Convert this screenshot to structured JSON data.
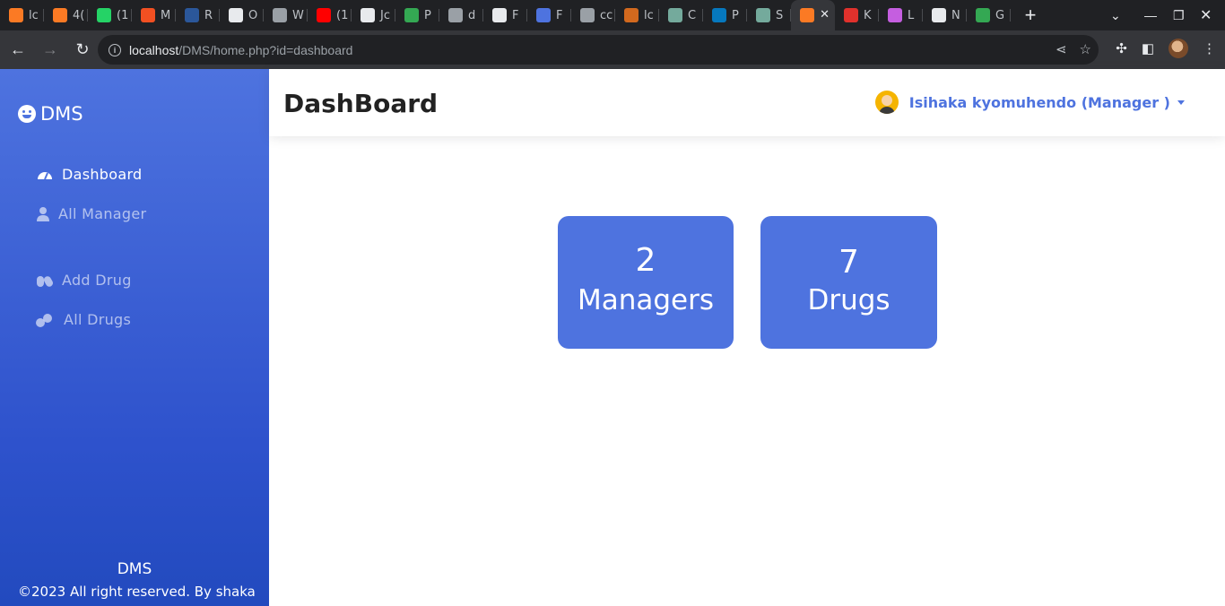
{
  "browser": {
    "tabs": [
      {
        "label": "lc",
        "icon": "xampp-icon",
        "color": "#fb7a24"
      },
      {
        "label": "4(",
        "icon": "xampp-icon",
        "color": "#fb7a24"
      },
      {
        "label": "(1",
        "icon": "whatsapp-icon",
        "color": "#25d366"
      },
      {
        "label": "M",
        "icon": "microsoft-icon",
        "color": "#f25022"
      },
      {
        "label": "R",
        "icon": "word-icon",
        "color": "#2b579a"
      },
      {
        "label": "O",
        "icon": "store-icon",
        "color": "#e8eaed"
      },
      {
        "label": "W",
        "icon": "globe-icon",
        "color": "#9aa0a6"
      },
      {
        "label": "(1",
        "icon": "youtube-icon",
        "color": "#ff0000"
      },
      {
        "label": "Jc",
        "icon": "github-icon",
        "color": "#e8eaed"
      },
      {
        "label": "P",
        "icon": "dot-icon",
        "color": "#34a853"
      },
      {
        "label": "d",
        "icon": "globe-icon",
        "color": "#9aa0a6"
      },
      {
        "label": "F",
        "icon": "flag-icon",
        "color": "#e8eaed"
      },
      {
        "label": "F",
        "icon": "flag-icon",
        "color": "#4e73df"
      },
      {
        "label": "cc",
        "icon": "leaf-icon",
        "color": "#9aa0a6"
      },
      {
        "label": "lc",
        "icon": "tent-icon",
        "color": "#d2691e"
      },
      {
        "label": "C",
        "icon": "openai-icon",
        "color": "#74aa9c"
      },
      {
        "label": "P",
        "icon": "drupal-icon",
        "color": "#0678be"
      },
      {
        "label": "S",
        "icon": "openai-icon",
        "color": "#74aa9c"
      },
      {
        "label": "",
        "icon": "xampp-icon",
        "color": "#fb7a24",
        "active": true
      },
      {
        "label": "K",
        "icon": "laravel-icon",
        "color": "#e0312c"
      },
      {
        "label": "L",
        "icon": "yii-icon",
        "color": "#c55ee0"
      },
      {
        "label": "N",
        "icon": "chrome-icon",
        "color": "#e8eaed"
      },
      {
        "label": "G",
        "icon": "meet-icon",
        "color": "#34a853"
      }
    ],
    "url_host": "localhost",
    "url_path": "/DMS/home.php?id=dashboard"
  },
  "sidebar": {
    "brand": "DMS",
    "items": [
      {
        "label": "Dashboard",
        "icon": "tachometer-icon",
        "active": true
      },
      {
        "label": "All Manager",
        "icon": "user-icon",
        "active": false
      },
      {
        "label": "Add Drug",
        "icon": "capsules-icon",
        "active": false
      },
      {
        "label": "All Drugs",
        "icon": "pills-icon",
        "active": false
      }
    ],
    "footer_title": "DMS",
    "footer_text": "©2023 All right reserved. By shaka"
  },
  "header": {
    "title": "DashBoard",
    "user": "Isihaka kyomuhendo (Manager )"
  },
  "cards": [
    {
      "value": "2",
      "label": "Managers"
    },
    {
      "value": "7",
      "label": "Drugs"
    }
  ],
  "colors": {
    "primary": "#4e73df",
    "sidebar_bottom": "#224abe"
  }
}
